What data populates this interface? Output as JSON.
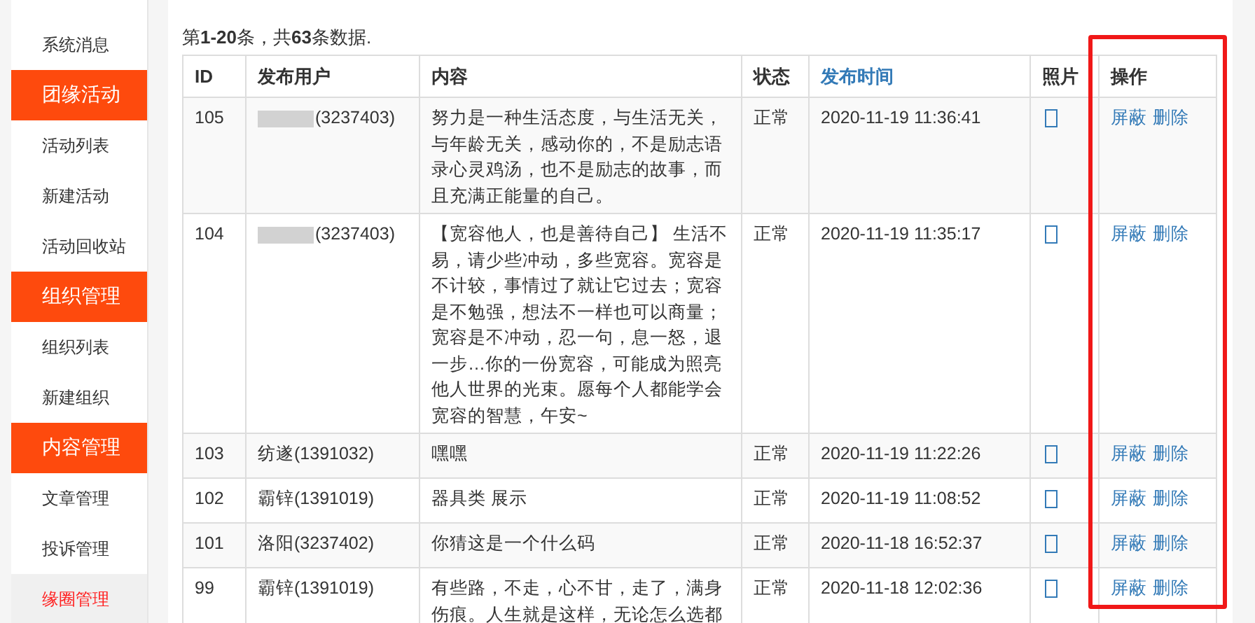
{
  "sidebar": {
    "items": [
      {
        "kind": "item",
        "label": "系统消息",
        "selected": false
      },
      {
        "kind": "header",
        "label": "团缘活动",
        "selected": false
      },
      {
        "kind": "item",
        "label": "活动列表",
        "selected": false
      },
      {
        "kind": "item",
        "label": "新建活动",
        "selected": false
      },
      {
        "kind": "item",
        "label": "活动回收站",
        "selected": false
      },
      {
        "kind": "header",
        "label": "组织管理",
        "selected": false
      },
      {
        "kind": "item",
        "label": "组织列表",
        "selected": false
      },
      {
        "kind": "item",
        "label": "新建组织",
        "selected": false
      },
      {
        "kind": "header",
        "label": "内容管理",
        "selected": false
      },
      {
        "kind": "item",
        "label": "文章管理",
        "selected": false
      },
      {
        "kind": "item",
        "label": "投诉管理",
        "selected": false
      },
      {
        "kind": "item",
        "label": "缘圈管理",
        "selected": true
      }
    ]
  },
  "summary": "第**1-20**条，共**63**条数据.",
  "table": {
    "columns": [
      {
        "label": "ID",
        "link": false,
        "highlighted": false
      },
      {
        "label": "发布用户",
        "link": false,
        "highlighted": false
      },
      {
        "label": "内容",
        "link": false,
        "highlighted": false
      },
      {
        "label": "状态",
        "link": false,
        "highlighted": false
      },
      {
        "label": "发布时间",
        "link": true,
        "highlighted": false
      },
      {
        "label": "照片",
        "link": false,
        "highlighted": false
      },
      {
        "label": "操作",
        "link": false,
        "highlighted": true
      }
    ],
    "rows": [
      {
        "id": "105",
        "user": "(3237403)",
        "redacted": true,
        "content": "努力是一种生活态度，与生活无关，与年龄无关，感动你的，不是励志语录心灵鸡汤，也不是励志的故事，而且充满正能量的自己。",
        "status": "正常",
        "time": "2020-11-19 11:36:41",
        "actions": [
          "屏蔽",
          "删除"
        ]
      },
      {
        "id": "104",
        "user": "(3237403)",
        "redacted": true,
        "content": "【宽容他人，也是善待自己】 生活不易，请少些冲动，多些宽容。宽容是不计较，事情过了就让它过去；宽容是不勉强，想法不一样也可以商量；宽容是不冲动，忍一句，息一怒，退一步…你的一份宽容，可能成为照亮他人世界的光束。愿每个人都能学会宽容的智慧，午安~",
        "status": "正常",
        "time": "2020-11-19 11:35:17",
        "actions": [
          "屏蔽",
          "删除"
        ]
      },
      {
        "id": "103",
        "user": "纺遂(1391032)",
        "redacted": false,
        "content": "嘿嘿",
        "status": "正常",
        "time": "2020-11-19 11:22:26",
        "actions": [
          "屏蔽",
          "删除"
        ]
      },
      {
        "id": "102",
        "user": "霸锌(1391019)",
        "redacted": false,
        "content": "器具类 展示",
        "status": "正常",
        "time": "2020-11-19 11:08:52",
        "actions": [
          "屏蔽",
          "删除"
        ]
      },
      {
        "id": "101",
        "user": "洛阳(3237402)",
        "redacted": false,
        "content": "你猜这是一个什么码",
        "status": "正常",
        "time": "2020-11-18 16:52:37",
        "actions": [
          "屏蔽",
          "删除"
        ]
      },
      {
        "id": "99",
        "user": "霸锌(1391019)",
        "redacted": false,
        "content": "有些路，不走，心不甘，走了，满身伤痕。人生就是这样，无论怎么选都",
        "status": "正常",
        "time": "2020-11-18 12:02:36",
        "actions": [
          "屏蔽",
          "删除"
        ]
      }
    ]
  }
}
